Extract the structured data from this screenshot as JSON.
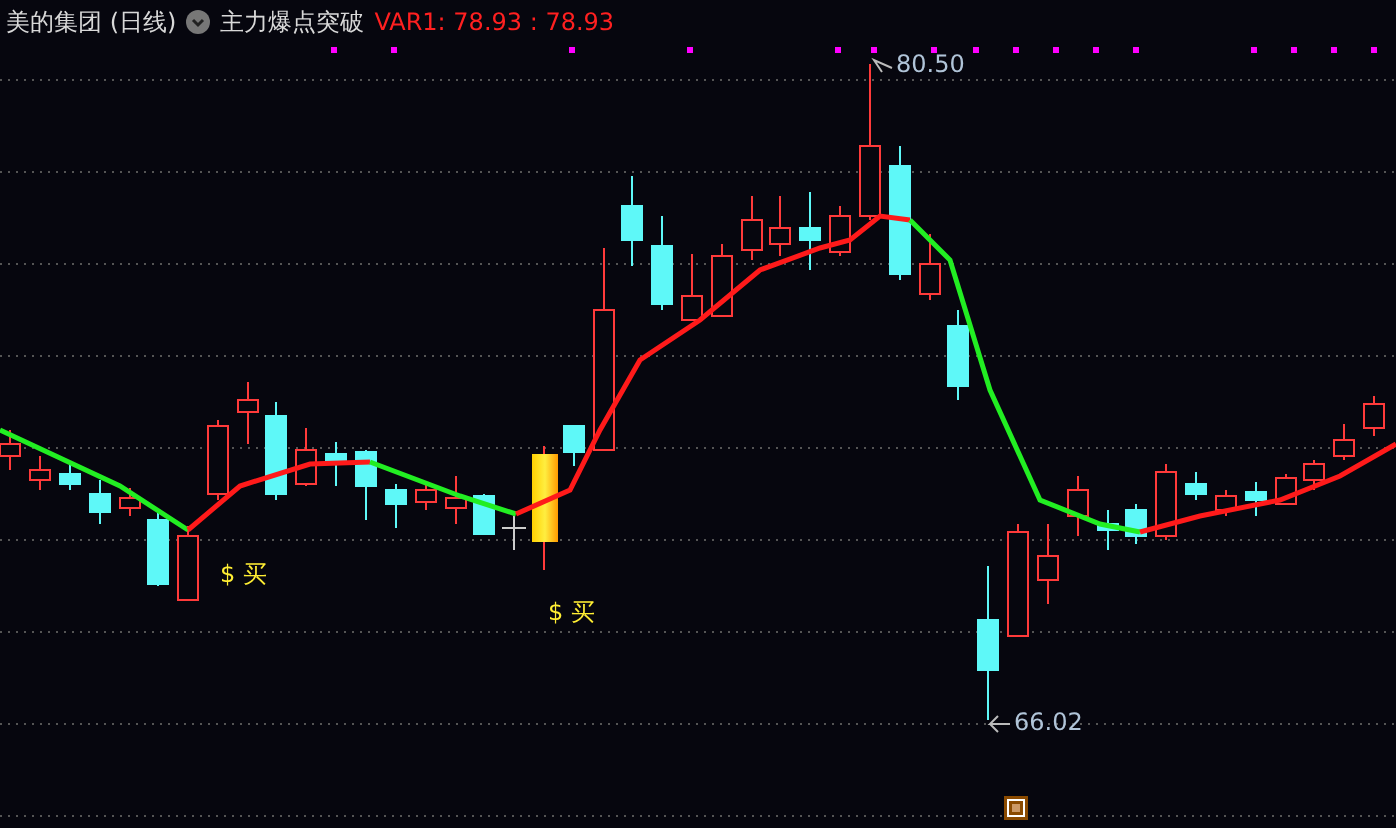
{
  "header": {
    "title": "美的集团 (日线)",
    "indicator": "主力爆点突破",
    "var_text": "VAR1: 78.93 : 78.93"
  },
  "chart": {
    "high_label": "80.50",
    "low_label": "66.02",
    "signals": [
      {
        "label": "$ 买"
      },
      {
        "label": "$ 买"
      }
    ]
  }
}
